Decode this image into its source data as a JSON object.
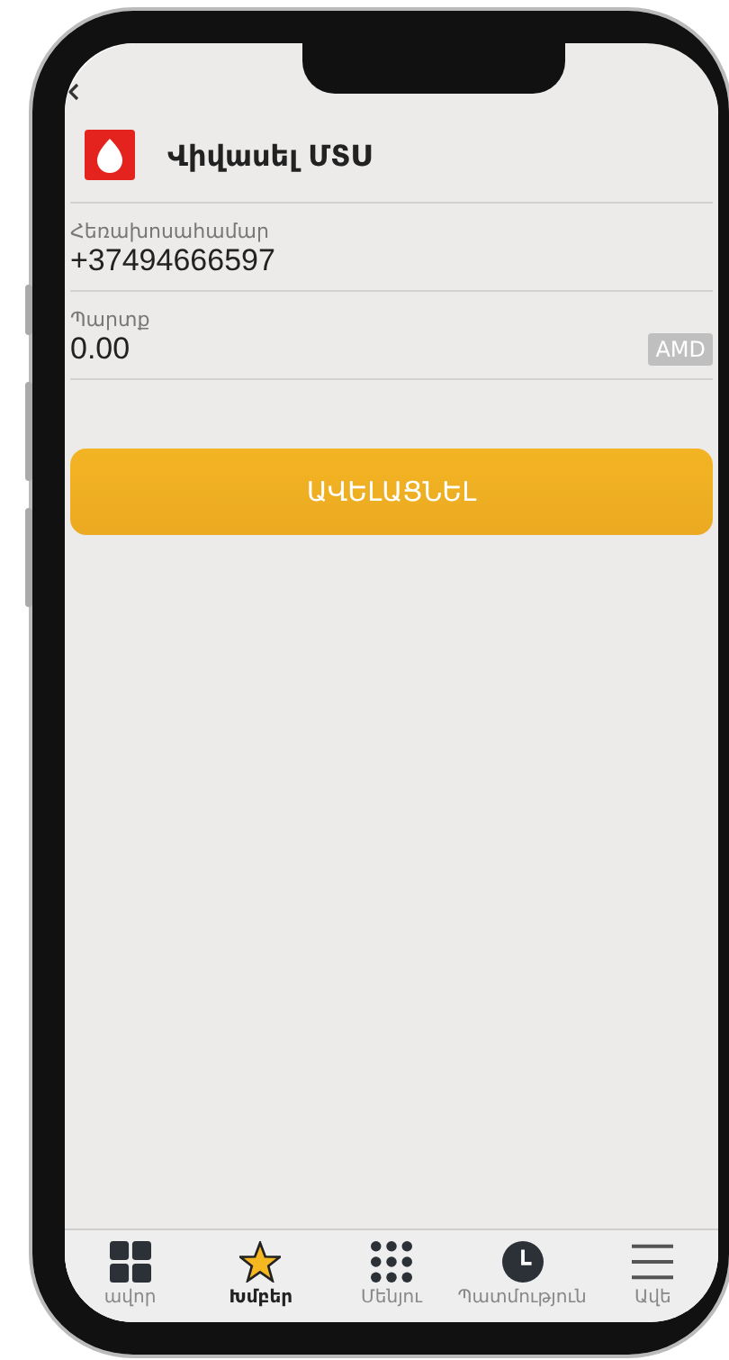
{
  "header": {
    "title": "Վիվասել ՄՏՍ"
  },
  "fields": [
    {
      "label": "Հեռախոսահամար",
      "value": "+37494666597"
    },
    {
      "label": "Պարտք",
      "value": "0.00",
      "unit": "AMD"
    }
  ],
  "button": {
    "label": "ԱՎԵԼԱՑՆԵԼ"
  },
  "tabs": [
    {
      "kind": "grid",
      "label": "ավոր",
      "selected": false
    },
    {
      "kind": "star",
      "label": "Խմբեր",
      "selected": true
    },
    {
      "kind": "dots",
      "label": "Մենյու",
      "selected": false
    },
    {
      "kind": "clock",
      "label": "Պատմություն",
      "selected": false
    },
    {
      "kind": "menu",
      "label": "Ավե",
      "selected": false
    }
  ]
}
